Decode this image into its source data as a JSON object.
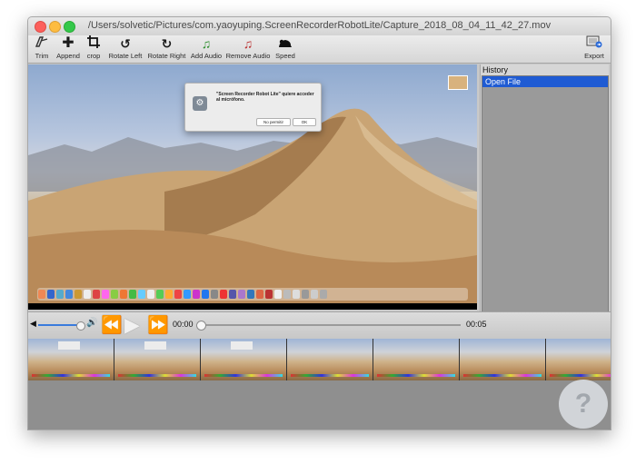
{
  "window": {
    "title": "/Users/solvetic/Pictures/com.yaoyuping.ScreenRecorderRobotLite/Capture_2018_08_04_11_42_27.mov"
  },
  "toolbar": {
    "items": [
      {
        "label": "Trim",
        "icon": "trim-icon"
      },
      {
        "label": "Append",
        "icon": "append-icon"
      },
      {
        "label": "crop",
        "icon": "crop-icon"
      },
      {
        "label": "Rotate Left",
        "icon": "rotate-left-icon"
      },
      {
        "label": "Rotate Right",
        "icon": "rotate-right-icon"
      },
      {
        "label": "Add Audio",
        "icon": "add-audio-icon"
      },
      {
        "label": "Remove Audio",
        "icon": "remove-audio-icon"
      },
      {
        "label": "Speed",
        "icon": "speed-icon"
      }
    ],
    "export_label": "Export"
  },
  "dialog": {
    "message": "\"Screen Recorder Robot Lite\" quiere acceder al micrófono.",
    "deny_label": "No permitir",
    "ok_label": "OK"
  },
  "history": {
    "title": "History",
    "items": [
      "Open File"
    ]
  },
  "player": {
    "current_time": "00:00",
    "total_time": "00:05",
    "progress": 0,
    "volume": 0.9
  },
  "colors": {
    "selection": "#1f5bd3",
    "volume_fill": "#3a7bdc"
  }
}
